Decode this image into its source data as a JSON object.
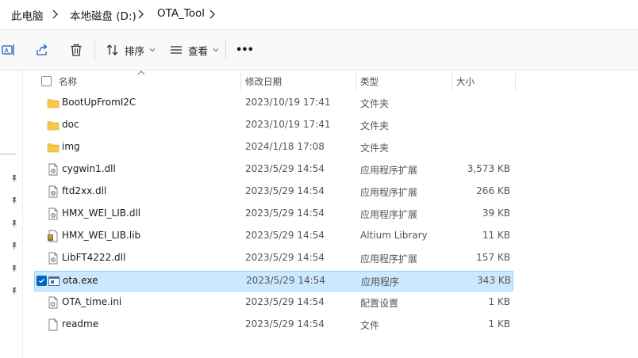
{
  "breadcrumb": {
    "items": [
      "此电脑",
      "本地磁盘 (D:)",
      "OTA_Tool"
    ]
  },
  "toolbar": {
    "sort_label": "排序",
    "view_label": "查看",
    "more_label": "•••"
  },
  "columns": {
    "name": "名称",
    "modified": "修改日期",
    "type": "类型",
    "size": "大小"
  },
  "files": [
    {
      "name": "BootUpFromI2C",
      "modified": "2023/10/19 17:41",
      "type": "文件夹",
      "size": "",
      "icon": "folder-icon"
    },
    {
      "name": "doc",
      "modified": "2023/10/19 17:41",
      "type": "文件夹",
      "size": "",
      "icon": "folder-icon"
    },
    {
      "name": "img",
      "modified": "2024/1/18 17:08",
      "type": "文件夹",
      "size": "",
      "icon": "folder-icon"
    },
    {
      "name": "cygwin1.dll",
      "modified": "2023/5/29 14:54",
      "type": "应用程序扩展",
      "size": "3,573 KB",
      "icon": "dll-file-icon"
    },
    {
      "name": "ftd2xx.dll",
      "modified": "2023/5/29 14:54",
      "type": "应用程序扩展",
      "size": "266 KB",
      "icon": "dll-file-icon"
    },
    {
      "name": "HMX_WEI_LIB.dll",
      "modified": "2023/5/29 14:54",
      "type": "应用程序扩展",
      "size": "39 KB",
      "icon": "dll-file-icon"
    },
    {
      "name": "HMX_WEI_LIB.lib",
      "modified": "2023/5/29 14:54",
      "type": "Altium Library",
      "size": "11 KB",
      "icon": "library-file-icon"
    },
    {
      "name": "LibFT4222.dll",
      "modified": "2023/5/29 14:54",
      "type": "应用程序扩展",
      "size": "157 KB",
      "icon": "dll-file-icon"
    },
    {
      "name": "ota.exe",
      "modified": "2023/5/29 14:54",
      "type": "应用程序",
      "size": "343 KB",
      "icon": "exe-file-icon",
      "selected": true
    },
    {
      "name": "OTA_time.ini",
      "modified": "2023/5/29 14:54",
      "type": "配置设置",
      "size": "1 KB",
      "icon": "ini-file-icon"
    },
    {
      "name": "readme",
      "modified": "2023/5/29 14:54",
      "type": "文件",
      "size": "1 KB",
      "icon": "generic-file-icon"
    }
  ],
  "colors": {
    "selection_bg": "#cce8ff",
    "selection_border": "#99d1ff",
    "folder": "#f8c84a",
    "accent": "#0067c0"
  }
}
